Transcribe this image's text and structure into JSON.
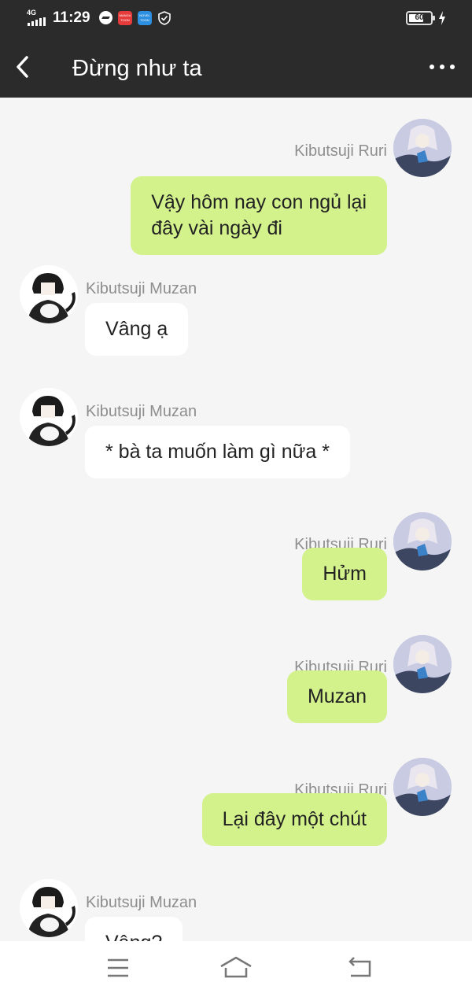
{
  "status_bar": {
    "network": "4G",
    "time": "11:29",
    "app_icon_1": "MANGA TOON",
    "app_icon_2": "NOVEL TOON",
    "battery": "60"
  },
  "header": {
    "title": "Đừng như ta"
  },
  "messages": [
    {
      "direction": "out",
      "sender": "Kibutsuji Ruri",
      "text_line1": "Vậy hôm nay con ngủ lại",
      "text_line2": "đây vài ngày đi"
    },
    {
      "direction": "in",
      "sender": "Kibutsuji Muzan",
      "text": "Vâng ạ"
    },
    {
      "direction": "in",
      "sender": "Kibutsuji Muzan",
      "text": "* bà ta muốn làm gì nữa *"
    },
    {
      "direction": "out",
      "sender": "Kibutsuji Ruri",
      "text": "Hửm"
    },
    {
      "direction": "out",
      "sender": "Kibutsuji Ruri",
      "text": "Muzan"
    },
    {
      "direction": "out",
      "sender": "Kibutsuji Ruri",
      "text": "Lại đây một chút"
    },
    {
      "direction": "in",
      "sender": "Kibutsuji Muzan",
      "text": "Vâng?"
    }
  ],
  "icons": {
    "back": "chevron-left-icon",
    "more": "more-dots-icon",
    "nav_menu": "menu-icon",
    "nav_home": "home-icon",
    "nav_back": "back-icon"
  }
}
